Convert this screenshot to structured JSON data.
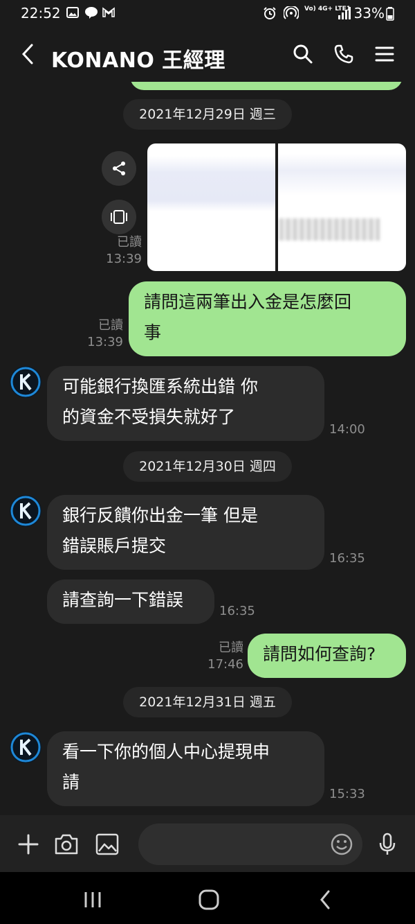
{
  "status_bar": {
    "time": "22:52",
    "network": "Vo) 4G+ LTE1",
    "battery": "33%"
  },
  "header": {
    "title": "KONANO 王經理"
  },
  "read_label": "已讀",
  "dates": [
    "2021年12月29日 週三",
    "2021年12月30日 週四",
    "2021年12月31日 週五"
  ],
  "messages": [
    {
      "type": "image",
      "read": "已讀",
      "time": "13:39"
    },
    {
      "type": "out",
      "text_lines": [
        "請問這兩筆出入金是怎麼回",
        "事"
      ],
      "read": "已讀",
      "time": "13:39"
    },
    {
      "type": "in",
      "text_lines": [
        "可能銀行換匯系統出錯  你",
        "的資金不受損失就好了"
      ],
      "time": "14:00"
    },
    {
      "type": "in",
      "text_lines": [
        "銀行反饋你出金一筆  但是",
        "錯誤賬戶提交"
      ],
      "time": "16:35"
    },
    {
      "type": "in",
      "text_lines": [
        "請查詢一下錯誤"
      ],
      "time": "16:35"
    },
    {
      "type": "out",
      "text_lines": [
        "請問如何查詢?"
      ],
      "read": "已讀",
      "time": "17:46"
    },
    {
      "type": "in",
      "text_lines": [
        "看一下你的個人中心提現申",
        "請"
      ],
      "time": "15:33"
    }
  ],
  "input": {
    "placeholder": ""
  },
  "colors": {
    "background": "#1b1b1b",
    "incoming_bubble": "#2c2c2c",
    "outgoing_bubble": "#a1e591",
    "avatar_blue": "#1e88d8"
  }
}
